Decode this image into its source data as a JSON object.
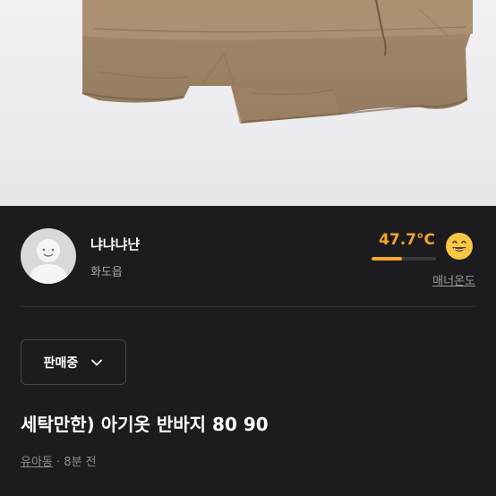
{
  "photo": {
    "alt_subject": "shorts"
  },
  "seller": {
    "nickname": "냐냐냐냔",
    "location": "화도읍",
    "manner_temp": "47.7°C",
    "manner_temp_value": 47.7,
    "manner_temp_fill_fraction": 0.47,
    "manner_label": "매너온도"
  },
  "status": {
    "selected": "판매중"
  },
  "post": {
    "title": "세탁만한) 아기옷 반바지 80 90",
    "category": "유아동",
    "separator": "·",
    "time_ago": "8분 전"
  },
  "colors": {
    "accent": "#f4a52b",
    "background": "#1c1c1e"
  }
}
